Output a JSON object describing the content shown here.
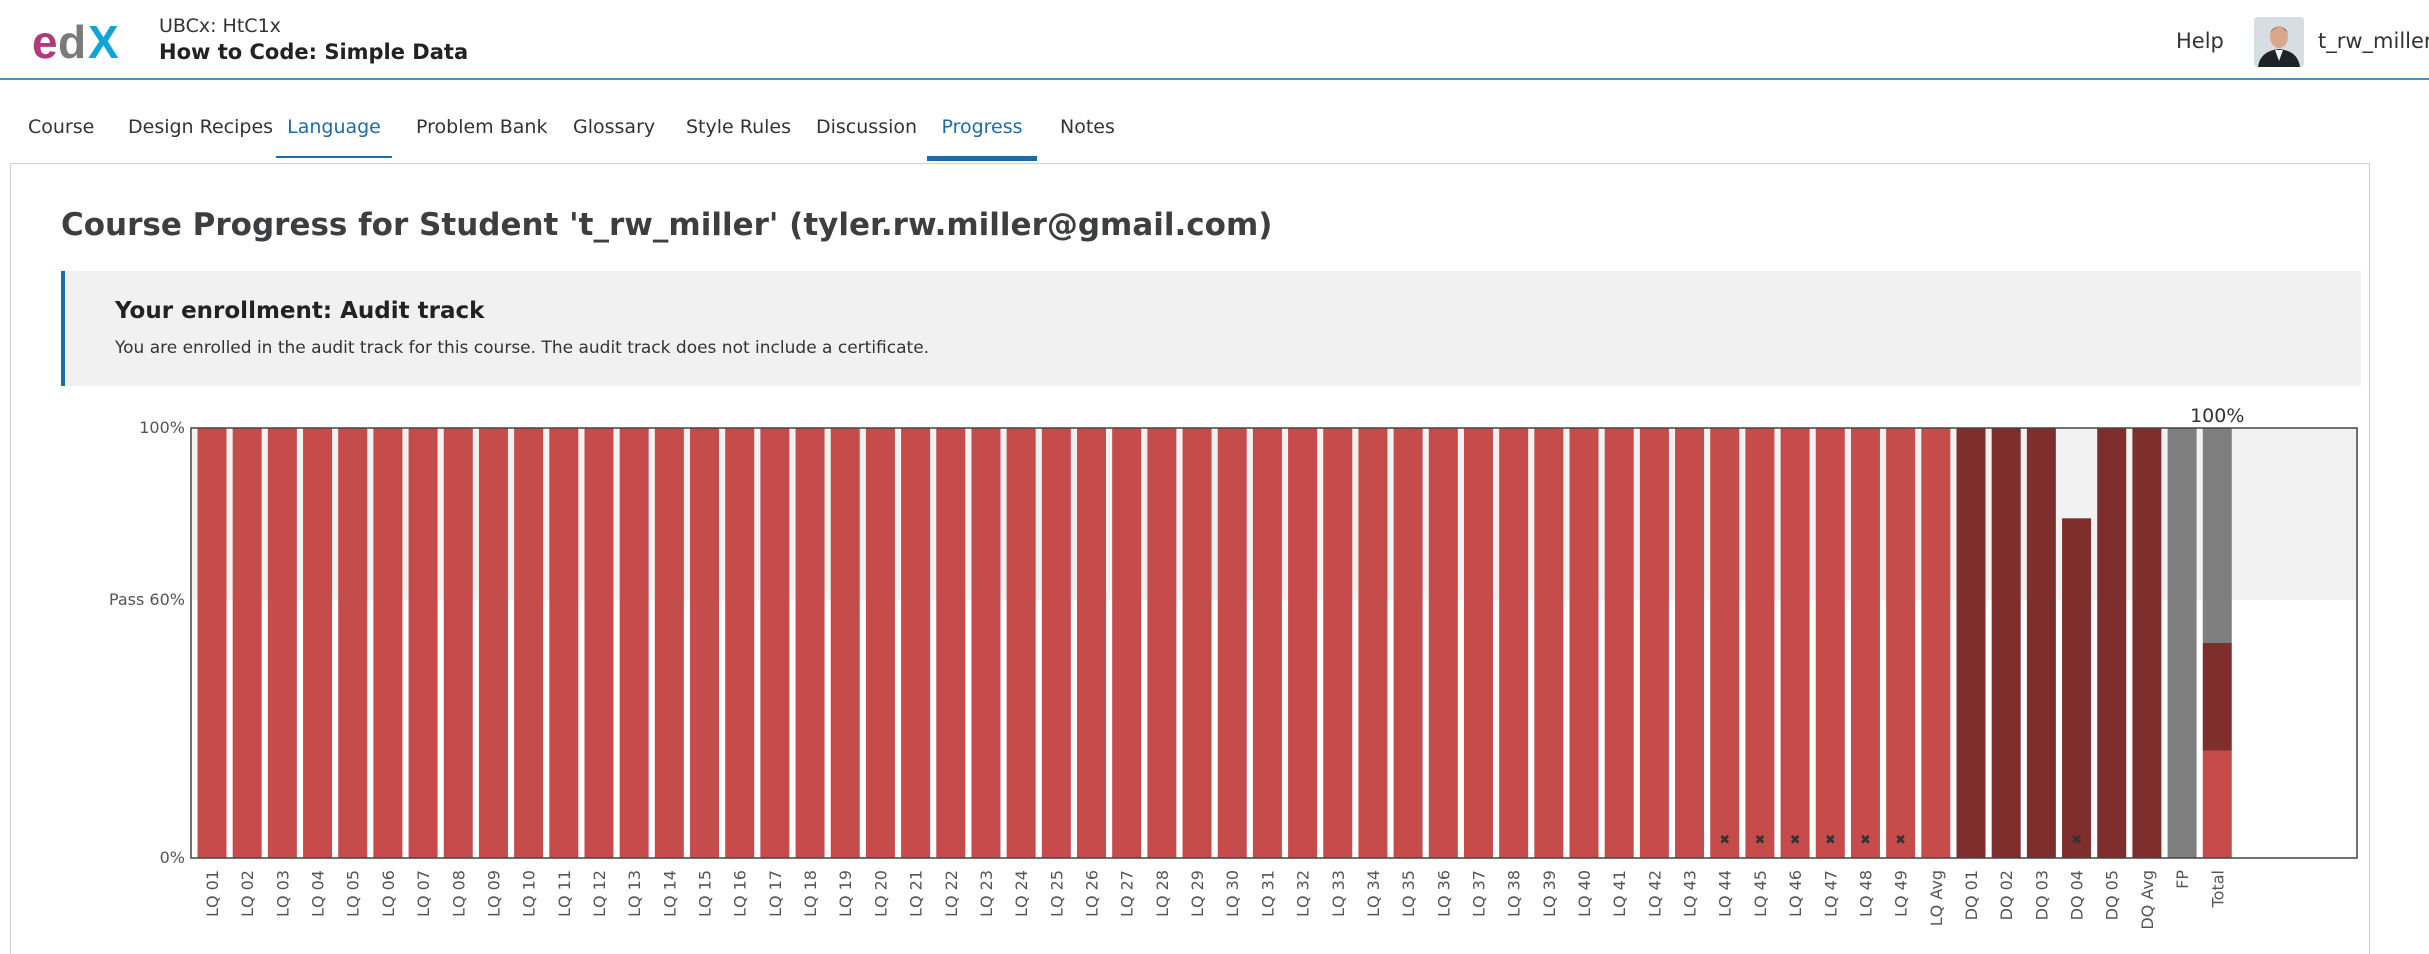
{
  "header": {
    "course_org": "UBCx: HtC1x",
    "course_name": "How to Code: Simple Data",
    "help_label": "Help",
    "username": "t_rw_miller"
  },
  "tabs": [
    "Course",
    "Design Recipes",
    "Language",
    "Problem Bank",
    "Glossary",
    "Style Rules",
    "Discussion",
    "Progress",
    "Notes"
  ],
  "page_title": "Course Progress for Student 't_rw_miller' (tyler.rw.miller@gmail.com)",
  "enrollment": {
    "title": "Your enrollment: Audit track",
    "message": "You are enrolled in the audit track for this course. The audit track does not include a certificate."
  },
  "colors": {
    "lq": "#c64b4b",
    "dq": "#7f2e2e",
    "fp": "#7f7f7f",
    "pass_band": "#f2f2f2",
    "link": "#1d6ca8"
  },
  "chart_data": {
    "type": "bar",
    "y_ticks": [
      "100%",
      "Pass 60%",
      "0%"
    ],
    "total_label": "100%",
    "ylim": [
      0,
      100
    ],
    "pass_line": 60,
    "categories": [
      "LQ 01",
      "LQ 02",
      "LQ 03",
      "LQ 04",
      "LQ 05",
      "LQ 06",
      "LQ 07",
      "LQ 08",
      "LQ 09",
      "LQ 10",
      "LQ 11",
      "LQ 12",
      "LQ 13",
      "LQ 14",
      "LQ 15",
      "LQ 16",
      "LQ 17",
      "LQ 18",
      "LQ 19",
      "LQ 20",
      "LQ 21",
      "LQ 22",
      "LQ 23",
      "LQ 24",
      "LQ 25",
      "LQ 26",
      "LQ 27",
      "LQ 28",
      "LQ 29",
      "LQ 30",
      "LQ 31",
      "LQ 32",
      "LQ 33",
      "LQ 34",
      "LQ 35",
      "LQ 36",
      "LQ 37",
      "LQ 38",
      "LQ 39",
      "LQ 40",
      "LQ 41",
      "LQ 42",
      "LQ 43",
      "LQ 44",
      "LQ 45",
      "LQ 46",
      "LQ 47",
      "LQ 48",
      "LQ 49",
      "LQ Avg",
      "DQ 01",
      "DQ 02",
      "DQ 03",
      "DQ 04",
      "DQ 05",
      "DQ Avg",
      "FP",
      "Total"
    ],
    "values": [
      100,
      100,
      100,
      100,
      100,
      100,
      100,
      100,
      100,
      100,
      100,
      100,
      100,
      100,
      100,
      100,
      100,
      100,
      100,
      100,
      100,
      100,
      100,
      100,
      100,
      100,
      100,
      100,
      100,
      100,
      100,
      100,
      100,
      100,
      100,
      100,
      100,
      100,
      100,
      100,
      100,
      100,
      100,
      100,
      100,
      100,
      100,
      100,
      100,
      100,
      100,
      100,
      100,
      79,
      100,
      100,
      100,
      100
    ],
    "groups": [
      "lq",
      "lq",
      "lq",
      "lq",
      "lq",
      "lq",
      "lq",
      "lq",
      "lq",
      "lq",
      "lq",
      "lq",
      "lq",
      "lq",
      "lq",
      "lq",
      "lq",
      "lq",
      "lq",
      "lq",
      "lq",
      "lq",
      "lq",
      "lq",
      "lq",
      "lq",
      "lq",
      "lq",
      "lq",
      "lq",
      "lq",
      "lq",
      "lq",
      "lq",
      "lq",
      "lq",
      "lq",
      "lq",
      "lq",
      "lq",
      "lq",
      "lq",
      "lq",
      "lq",
      "lq",
      "lq",
      "lq",
      "lq",
      "lq",
      "lq",
      "dq",
      "dq",
      "dq",
      "dq",
      "dq",
      "dq",
      "fp",
      "total"
    ],
    "dropped": [
      "LQ 44",
      "LQ 45",
      "LQ 46",
      "LQ 47",
      "LQ 48",
      "LQ 49",
      "DQ 04"
    ],
    "total_breakdown": [
      {
        "group": "lq",
        "value": 25
      },
      {
        "group": "dq",
        "value": 25
      },
      {
        "group": "fp",
        "value": 50
      }
    ]
  }
}
